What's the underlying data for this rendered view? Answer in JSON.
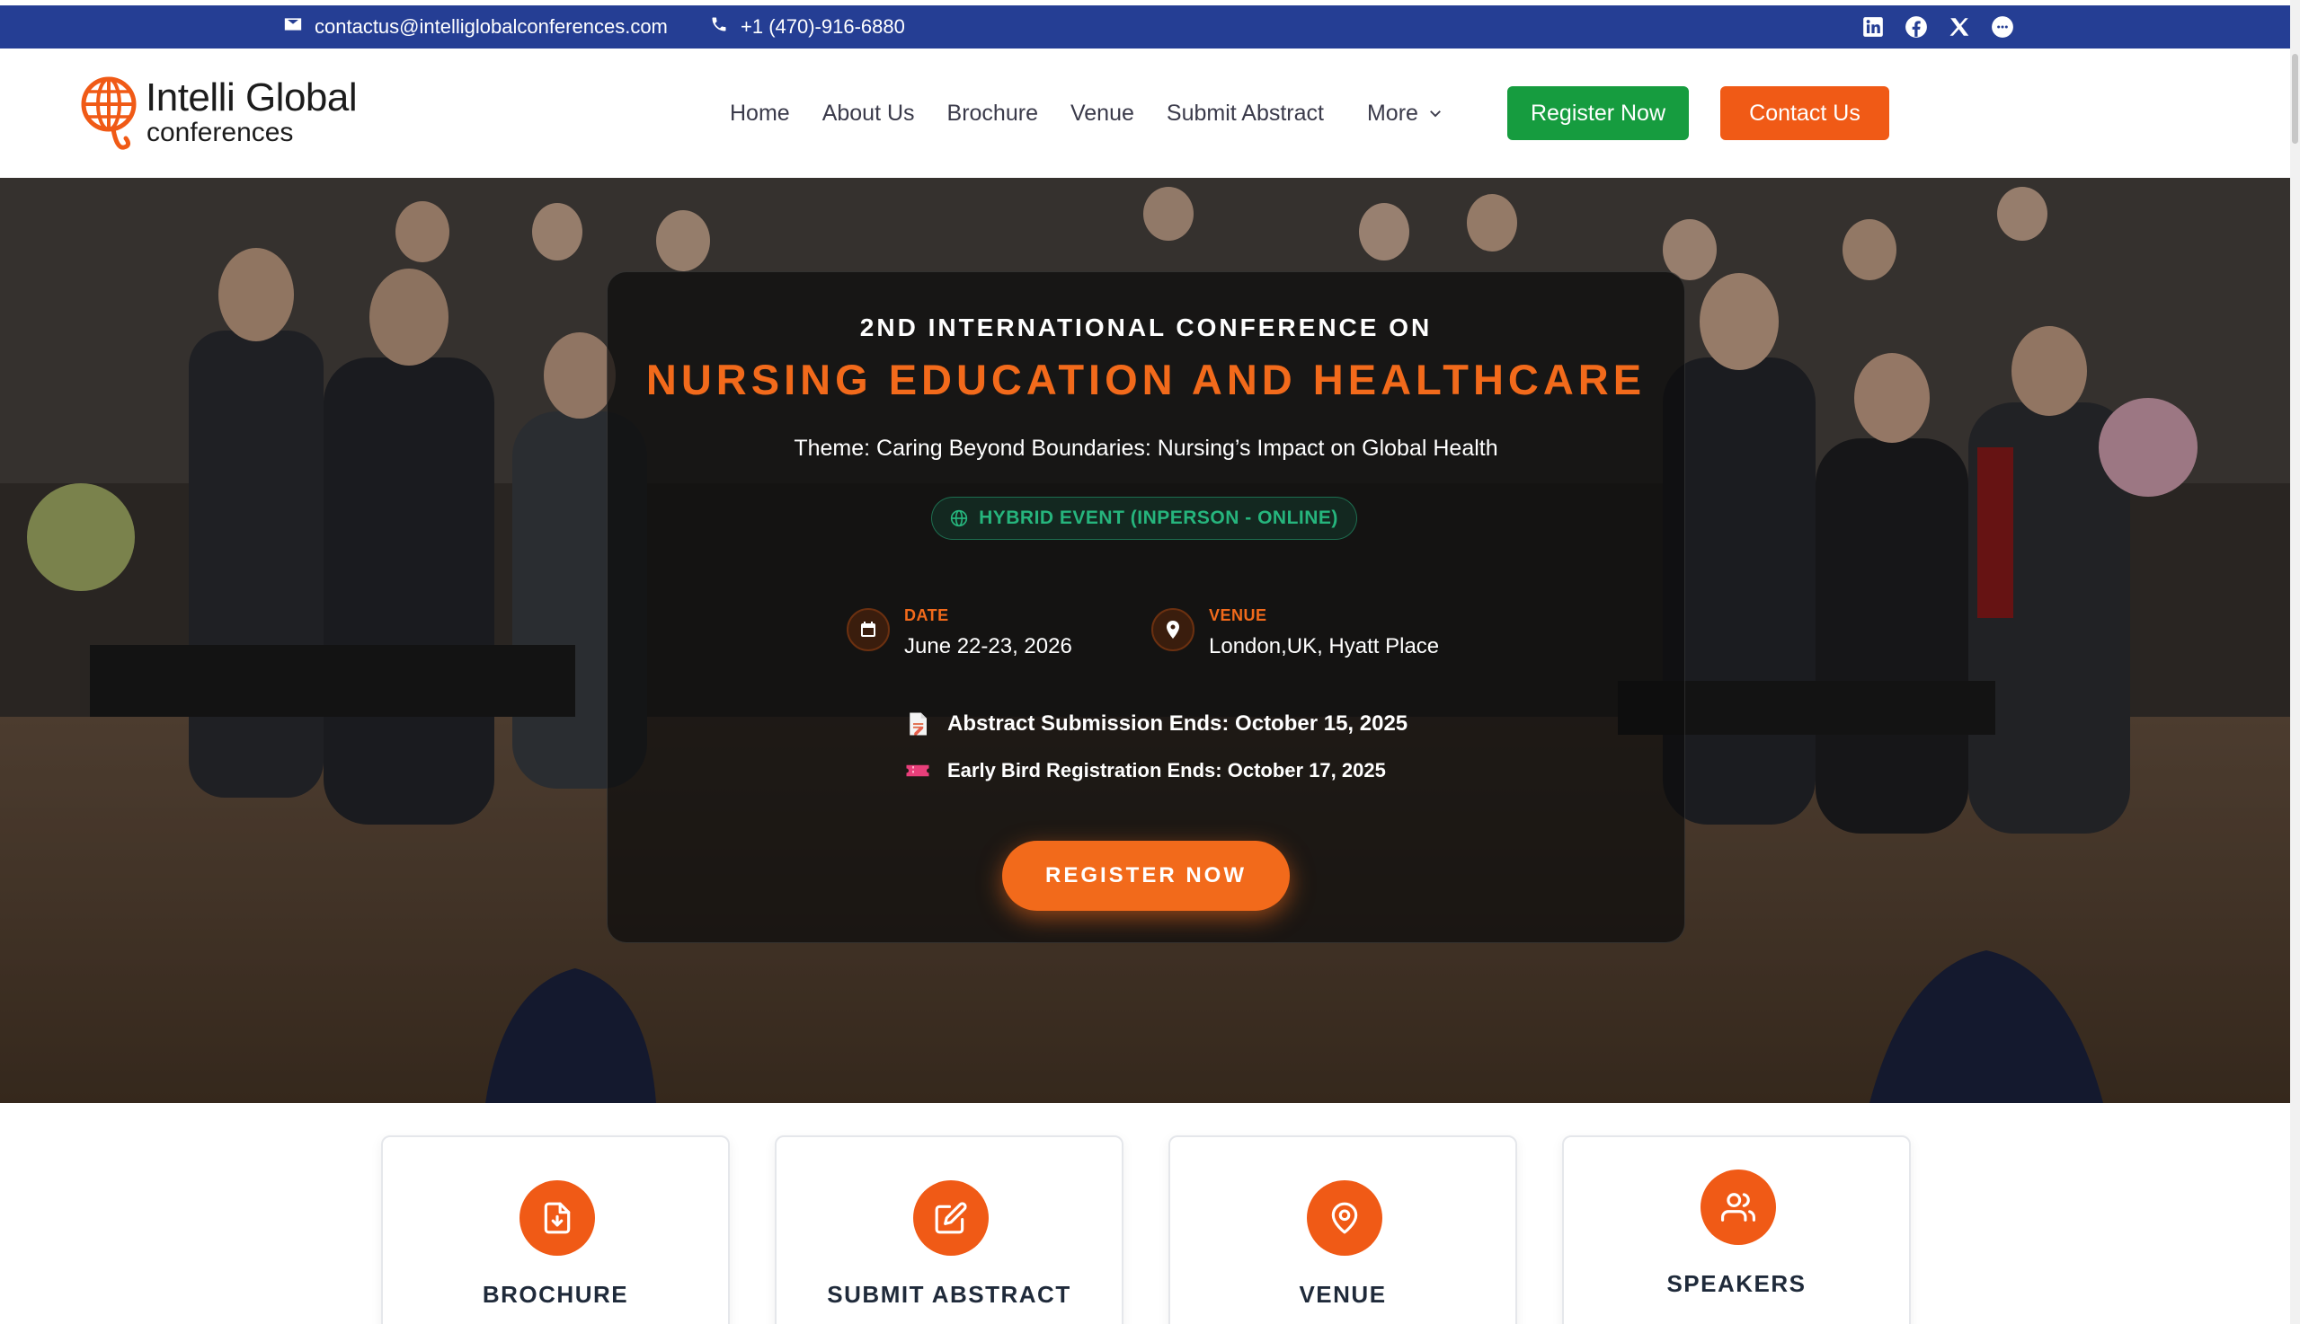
{
  "topbar": {
    "email": "contactus@intelliglobalconferences.com",
    "phone": "+1 (470)-916-6880",
    "socials": [
      "linkedin-icon",
      "facebook-icon",
      "x-icon",
      "chat-icon"
    ]
  },
  "logo": {
    "line1": "Intelli Global",
    "line2": "conferences"
  },
  "nav": {
    "items": [
      "Home",
      "About Us",
      "Brochure",
      "Venue",
      "Submit Abstract"
    ],
    "more": "More",
    "register": "Register Now",
    "contact": "Contact Us"
  },
  "hero": {
    "pre_title": "2ND INTERNATIONAL CONFERENCE ON",
    "title": "NURSING EDUCATION AND HEALTHCARE",
    "theme": "Theme: Caring Beyond Boundaries: Nursing’s Impact on Global Health",
    "event_type": "HYBRID EVENT (INPERSON - ONLINE)",
    "date_label": "DATE",
    "date_value": "June 22-23, 2026",
    "venue_label": "VENUE",
    "venue_value": "London,UK, Hyatt Place",
    "deadline_abstract": "Abstract Submission Ends: October 15, 2025",
    "deadline_early": "Early Bird Registration Ends: October 17, 2025",
    "cta": "REGISTER NOW"
  },
  "features": [
    {
      "label": "BROCHURE",
      "icon": "file-download-icon"
    },
    {
      "label": "SUBMIT ABSTRACT",
      "icon": "edit-icon"
    },
    {
      "label": "VENUE",
      "icon": "location-pin-icon"
    },
    {
      "label": "SPEAKERS",
      "icon": "users-icon"
    }
  ],
  "colors": {
    "topbar": "#253e94",
    "accent": "#f26a1b",
    "green": "#169c3f",
    "hybrid": "#26b57d"
  }
}
